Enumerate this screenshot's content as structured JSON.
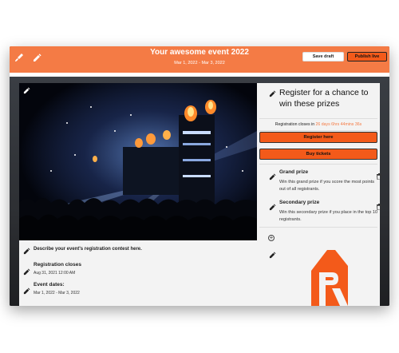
{
  "header": {
    "title": "Your awesome event 2022",
    "dates": "Mar 1, 2022 - Mar 3, 2022",
    "save_draft_label": "Save draft",
    "publish_label": "Publish live",
    "accent_color": "#f47b45"
  },
  "contest": {
    "description": "Describe your event's registration contest here.",
    "registration_closes_label": "Registration closes",
    "registration_closes_value": "Aug 31, 2021 12:00 AM",
    "event_dates_label": "Event dates:",
    "event_dates_value": "Mar 1, 2022 - Mar 3, 2022"
  },
  "prizes_panel": {
    "heading": "Register for a chance to win these prizes",
    "closes_prefix": "Registration closes in ",
    "countdown": "26 days 6hrs 44mins 36s",
    "register_label": "Register here",
    "tickets_label": "Buy tickets",
    "prizes": [
      {
        "name": "Grand prize",
        "description": "Win this grand prize if you score the most points out of all registrants."
      },
      {
        "name": "Secondary prize",
        "description": "Win this secondary prize if you place in the top 10 registrants."
      }
    ]
  },
  "icons": {
    "brush": "brush-icon",
    "pencil": "pencil-icon",
    "trash": "trash-icon",
    "add": "plus-circle-icon"
  }
}
